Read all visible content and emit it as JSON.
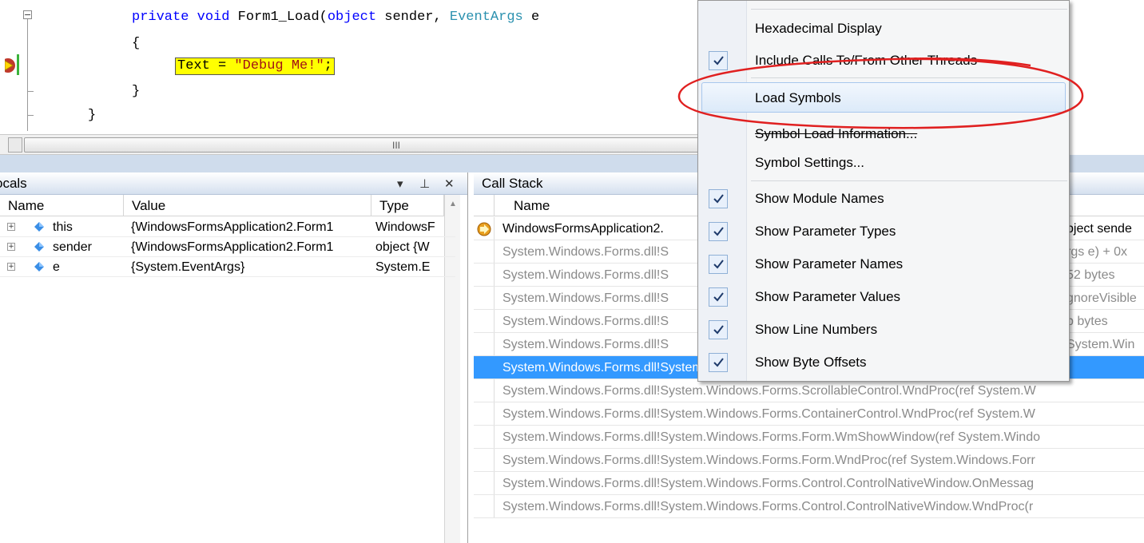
{
  "editor": {
    "sig_kw1": "private",
    "sig_kw2": "void",
    "sig_method": "Form1_Load(",
    "sig_kw3": "object",
    "sig_mid": "sender,",
    "sig_type": "EventArgs",
    "sig_end": "e",
    "open_brace": "{",
    "stmt_prefix": "Text = ",
    "stmt_string": "\"Debug Me!\"",
    "stmt_suffix": ";",
    "close_brace": "}",
    "close_brace2": "}",
    "scroll_grip": "III"
  },
  "locals": {
    "title": "ocals",
    "dropdown_glyph": "▾",
    "pin_glyph": "ф",
    "close_glyph": "✕",
    "columns": [
      "Name",
      "Value",
      "Type"
    ],
    "rows": [
      {
        "name": "this",
        "value": "{WindowsFormsApplication2.Form1",
        "type": "WindowsF"
      },
      {
        "name": "sender",
        "value": "{WindowsFormsApplication2.Form1",
        "type": "object {W"
      },
      {
        "name": "e",
        "value": "{System.EventArgs}",
        "type": "System.E"
      }
    ]
  },
  "callstack": {
    "title": "Call Stack",
    "column": "Name",
    "rows": [
      {
        "left": "WindowsFormsApplication2.",
        "right": "pject sende"
      },
      {
        "left": "System.Windows.Forms.dll!S",
        "right": "rgs e) + 0x"
      },
      {
        "left": "System.Windows.Forms.dll!S",
        "right": "52 bytes"
      },
      {
        "left": "System.Windows.Forms.dll!S",
        "right": "gnoreVisible"
      },
      {
        "left": "System.Windows.Forms.dll!S",
        "right": "b bytes"
      },
      {
        "left": "System.Windows.Forms.dll!S",
        "right": "System.Win"
      },
      {
        "full": "System.Windows.Forms.dll!System.Windows.Forms.Control.WndProc(ref System.Windows.Fo"
      },
      {
        "full": "System.Windows.Forms.dll!System.Windows.Forms.ScrollableControl.WndProc(ref System.W"
      },
      {
        "full": "System.Windows.Forms.dll!System.Windows.Forms.ContainerControl.WndProc(ref System.W"
      },
      {
        "full": "System.Windows.Forms.dll!System.Windows.Forms.Form.WmShowWindow(ref System.Windo"
      },
      {
        "full": "System.Windows.Forms.dll!System.Windows.Forms.Form.WndProc(ref System.Windows.Forr"
      },
      {
        "full": "System.Windows.Forms.dll!System.Windows.Forms.Control.ControlNativeWindow.OnMessag"
      },
      {
        "full": "System.Windows.Forms.dll!System.Windows.Forms.Control.ControlNativeWindow.WndProc(r"
      }
    ]
  },
  "menu": {
    "items": [
      {
        "label": "Hexadecimal Display",
        "checked": false
      },
      {
        "label": "Include Calls To/From Other Threads",
        "checked": true
      },
      {
        "label": "Load Symbols",
        "checked": false
      },
      {
        "label": "Symbol Load Information...",
        "checked": false
      },
      {
        "label": "Symbol Settings...",
        "checked": false
      },
      {
        "label": "Show Module Names",
        "checked": true
      },
      {
        "label": "Show Parameter Types",
        "checked": true
      },
      {
        "label": "Show Parameter Names",
        "checked": true
      },
      {
        "label": "Show Parameter Values",
        "checked": true
      },
      {
        "label": "Show Line Numbers",
        "checked": true
      },
      {
        "label": "Show Byte Offsets",
        "checked": true
      }
    ]
  },
  "colors": {
    "selection": "#3399ff",
    "annotation": "#e02020",
    "highlight": "#ffff00"
  }
}
